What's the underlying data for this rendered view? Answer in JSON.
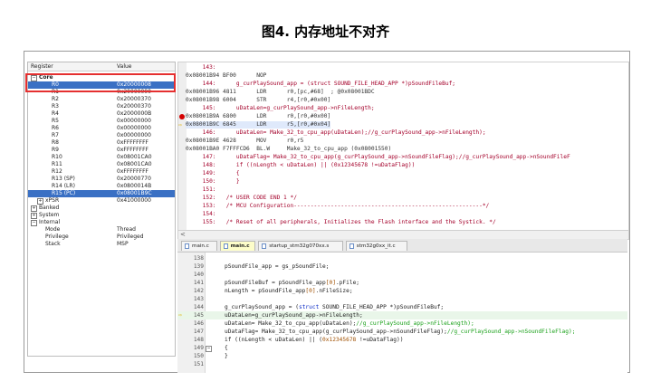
{
  "caption": "图4. 内存地址不对齐",
  "registers": {
    "col_register": "Register",
    "col_value": "Value",
    "rows": [
      {
        "name": "Core",
        "value": "",
        "level": 0,
        "toggle": "−",
        "selected": false,
        "bold": true
      },
      {
        "name": "R0",
        "value": "0x20000008",
        "level": 2,
        "toggle": "",
        "selected": true,
        "bold": false
      },
      {
        "name": "R1",
        "value": "0x20000000",
        "level": 2,
        "toggle": "",
        "selected": false,
        "bold": false
      },
      {
        "name": "R2",
        "value": "0x20000370",
        "level": 2,
        "toggle": "",
        "selected": false,
        "bold": false
      },
      {
        "name": "R3",
        "value": "0x20000370",
        "level": 2,
        "toggle": "",
        "selected": false,
        "bold": false
      },
      {
        "name": "R4",
        "value": "0x2000000B",
        "level": 2,
        "toggle": "",
        "selected": false,
        "bold": false
      },
      {
        "name": "R5",
        "value": "0x00000000",
        "level": 2,
        "toggle": "",
        "selected": false,
        "bold": false
      },
      {
        "name": "R6",
        "value": "0x00000000",
        "level": 2,
        "toggle": "",
        "selected": false,
        "bold": false
      },
      {
        "name": "R7",
        "value": "0x00000000",
        "level": 2,
        "toggle": "",
        "selected": false,
        "bold": false
      },
      {
        "name": "R8",
        "value": "0xFFFFFFFF",
        "level": 2,
        "toggle": "",
        "selected": false,
        "bold": false
      },
      {
        "name": "R9",
        "value": "0xFFFFFFFF",
        "level": 2,
        "toggle": "",
        "selected": false,
        "bold": false
      },
      {
        "name": "R10",
        "value": "0x08001CA0",
        "level": 2,
        "toggle": "",
        "selected": false,
        "bold": false
      },
      {
        "name": "R11",
        "value": "0x08001CA0",
        "level": 2,
        "toggle": "",
        "selected": false,
        "bold": false
      },
      {
        "name": "R12",
        "value": "0xFFFFFFFF",
        "level": 2,
        "toggle": "",
        "selected": false,
        "bold": false
      },
      {
        "name": "R13 (SP)",
        "value": "0x20000770",
        "level": 2,
        "toggle": "",
        "selected": false,
        "bold": false
      },
      {
        "name": "R14 (LR)",
        "value": "0x0800014B",
        "level": 2,
        "toggle": "",
        "selected": false,
        "bold": false
      },
      {
        "name": "R15 (PC)",
        "value": "0x08001B9C",
        "level": 2,
        "toggle": "",
        "selected": true,
        "bold": false
      },
      {
        "name": "xPSR",
        "value": "0x41000000",
        "level": 1,
        "toggle": "+",
        "selected": false,
        "bold": false
      },
      {
        "name": "Banked",
        "value": "",
        "level": 0,
        "toggle": "+",
        "selected": false,
        "bold": false
      },
      {
        "name": "System",
        "value": "",
        "level": 0,
        "toggle": "+",
        "selected": false,
        "bold": false
      },
      {
        "name": "Internal",
        "value": "",
        "level": 0,
        "toggle": "−",
        "selected": false,
        "bold": false
      },
      {
        "name": "Mode",
        "value": "Thread",
        "level": 1,
        "toggle": "",
        "selected": false,
        "bold": false
      },
      {
        "name": "Privilege",
        "value": "Privileged",
        "level": 1,
        "toggle": "",
        "selected": false,
        "bold": false
      },
      {
        "name": "Stack",
        "value": "MSP",
        "level": 1,
        "toggle": "",
        "selected": false,
        "bold": false
      }
    ]
  },
  "disassembly": {
    "lines": [
      {
        "text": "     143:",
        "type": "src",
        "marker": ""
      },
      {
        "text": "0x08001B94 BF00      NOP",
        "type": "asm",
        "marker": ""
      },
      {
        "text": "     144:      g_curPlaySound_app = (struct SOUND_FILE_HEAD_APP *)pSoundFileBuf;",
        "type": "src",
        "marker": ""
      },
      {
        "text": "0x08001B96 4811      LDR      r0,[pc,#68]  ; @0x08001BDC",
        "type": "asm",
        "marker": ""
      },
      {
        "text": "0x08001B98 6004      STR      r4,[r0,#0x00]",
        "type": "asm",
        "marker": ""
      },
      {
        "text": "     145:      uDataLen=g_curPlaySound_app->nFileLength;",
        "type": "src",
        "marker": ""
      },
      {
        "text": "0x08001B9A 6800      LDR      r0,[r0,#0x00]",
        "type": "asm",
        "marker": "breakpoint"
      },
      {
        "text": "0x08001B9C 6845      LDR      r5,[r0,#0x04]",
        "type": "asm",
        "marker": "pc"
      },
      {
        "text": "     146:      uDataLen= Make_32_to_cpu_app(uDataLen);//g_curPlaySound_app->nFileLength);",
        "type": "src",
        "marker": ""
      },
      {
        "text": "0x08001B9E 4628      MOV      r0,r5",
        "type": "asm",
        "marker": ""
      },
      {
        "text": "0x08001BA0 F7FFFCD6  BL.W     Make_32_to_cpu_app (0x08001550)",
        "type": "asm",
        "marker": ""
      },
      {
        "text": "     147:      uDataFlag= Make_32_to_cpu_app(g_curPlaySound_app->nSoundFileFlag);//g_curPlaySound_app->nSoundFileF",
        "type": "src",
        "marker": ""
      },
      {
        "text": "     148:      if ((nLength < uDataLen) || (0x12345678 !=uDataFlag))",
        "type": "src",
        "marker": ""
      },
      {
        "text": "     149:      {",
        "type": "src",
        "marker": ""
      },
      {
        "text": "     150:      }",
        "type": "src",
        "marker": ""
      },
      {
        "text": "     151:",
        "type": "src",
        "marker": ""
      },
      {
        "text": "     152:   /* USER CODE END 1 */",
        "type": "src",
        "marker": ""
      },
      {
        "text": "     153:   /* MCU Configuration--------------------------------------------------------*/",
        "type": "src",
        "marker": ""
      },
      {
        "text": "     154:",
        "type": "src",
        "marker": ""
      },
      {
        "text": "     155:   /* Reset of all peripherals, Initializes the Flash interface and the Systick. */",
        "type": "src",
        "marker": ""
      }
    ],
    "scroll_left": "<"
  },
  "tabs": [
    {
      "label": "main.c",
      "active": false
    },
    {
      "label": "main.c",
      "active": true
    },
    {
      "label": "startup_stm32g070xx.s",
      "active": false
    },
    {
      "label": "stm32g0xx_it.c",
      "active": false
    }
  ],
  "editor": {
    "lines": [
      {
        "num": "138",
        "code": "",
        "marker": "",
        "fold": ""
      },
      {
        "num": "139",
        "code": "pSoundFile_app = gs_pSoundFile;",
        "marker": "",
        "fold": ""
      },
      {
        "num": "140",
        "code": "",
        "marker": "",
        "fold": ""
      },
      {
        "num": "141",
        "code": "pSoundFileBuf = pSoundFile_app[0].pFile;",
        "marker": "",
        "fold": ""
      },
      {
        "num": "142",
        "code": "nLength = pSoundFile_app[0].nFileSize;",
        "marker": "",
        "fold": ""
      },
      {
        "num": "143",
        "code": "",
        "marker": "",
        "fold": ""
      },
      {
        "num": "144",
        "code": "g_curPlaySound_app = (struct SOUND_FILE_HEAD_APP *)pSoundFileBuf;",
        "marker": "",
        "fold": ""
      },
      {
        "num": "145",
        "code": "uDataLen=g_curPlaySound_app->nFileLength;",
        "marker": "pc",
        "fold": ""
      },
      {
        "num": "146",
        "code": "uDataLen= Make_32_to_cpu_app(uDataLen);//g_curPlaySound_app->nFileLength);",
        "marker": "",
        "fold": ""
      },
      {
        "num": "147",
        "code": "uDataFlag= Make_32_to_cpu_app(g_curPlaySound_app->nSoundFileFlag);//g_curPlaySound_app->nSoundFileFlag);",
        "marker": "",
        "fold": ""
      },
      {
        "num": "148",
        "code": "if ((nLength < uDataLen) || (0x12345678 !=uDataFlag))",
        "marker": "",
        "fold": ""
      },
      {
        "num": "149",
        "code": "{",
        "marker": "",
        "fold": "−"
      },
      {
        "num": "150",
        "code": "}",
        "marker": "",
        "fold": ""
      },
      {
        "num": "151",
        "code": "",
        "marker": "",
        "fold": ""
      }
    ]
  },
  "colors": {
    "highlight_box": "#e53030",
    "selected_row": "#3a70c4",
    "breakpoint": "#d40000",
    "pc_arrow": "#e0b000",
    "comment": "#19a019",
    "keyword": "#1030c8"
  }
}
